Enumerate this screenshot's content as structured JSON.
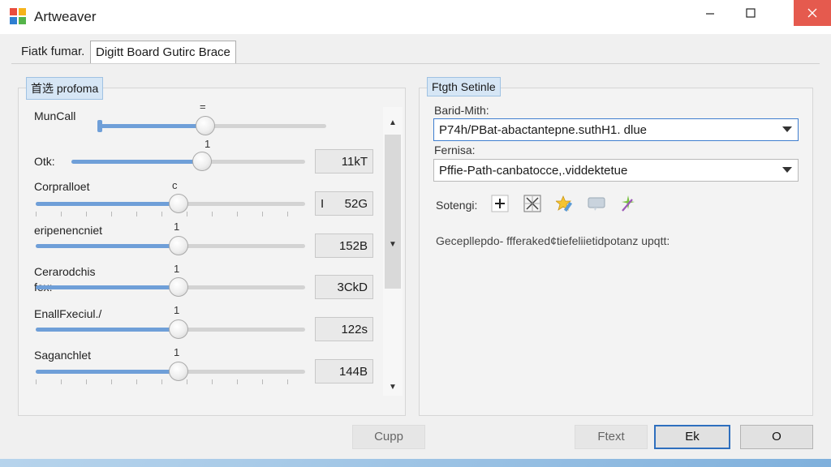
{
  "window": {
    "title": "Artweaver",
    "controls": {
      "minimize_icon": "minimize-icon",
      "maximize_icon": "maximize-icon",
      "close_icon": "close-icon"
    },
    "close_color": "#e55a4e"
  },
  "tabs": [
    {
      "label": "Fiatk fumar.",
      "active": false
    },
    {
      "label": "Digitt Board  Gutirc Brace",
      "active": true
    }
  ],
  "left_panel": {
    "title": "首选 profoma",
    "sliders": [
      {
        "label": "MunCall",
        "mark": "=",
        "value_text": "",
        "level_percent": 47
      },
      {
        "label": "Otk:",
        "mark": "1",
        "value_text": "11kT",
        "level_percent": 56
      },
      {
        "label": "Corpralloet",
        "mark": "c",
        "value_text": "52G",
        "value_prefix": "I",
        "level_percent": 53
      },
      {
        "label": "eripenencniet",
        "mark": "1",
        "value_text": "152B",
        "level_percent": 53
      },
      {
        "label": "Cerarodchis",
        "label2": "fex:",
        "mark": "1",
        "value_text": "3CkD",
        "level_percent": 53
      },
      {
        "label": "EnallFxeciul./",
        "mark": "1",
        "value_text": "122s",
        "level_percent": 53
      },
      {
        "label": "Saganchlet",
        "mark": "1",
        "value_text": "144B",
        "level_percent": 53
      }
    ],
    "scrollbar": {
      "up_icon": "scroll-up-arrow-icon",
      "down_icon": "scroll-down-arrow-icon"
    }
  },
  "right_panel": {
    "title": "Ftgth Setinle",
    "field1_label": "Barid-Mith:",
    "field1_value": "P74h/PBat-abactantepne.suthH1. dlue",
    "field2_label": "Fernisa:",
    "field2_value": "Pffie-Path-canbatocce,.viddektetue",
    "settings_label": "Sotengi:",
    "tool_icons": [
      "plus-icon",
      "grid-x-icon",
      "star-pencil-icon",
      "speech-bubble-icon",
      "sparkle-pen-icon"
    ],
    "hint": "Gecepllepdo- ffferaked¢tiefeliietidpotanz upqtt:"
  },
  "buttons": {
    "copy": "Cupp",
    "text": "Ftext",
    "ok": "Ek",
    "other": "O"
  },
  "colors": {
    "accent": "#3f7ecf",
    "slider_fill": "#6f9fd8",
    "group_header": "#d6e6f5"
  }
}
